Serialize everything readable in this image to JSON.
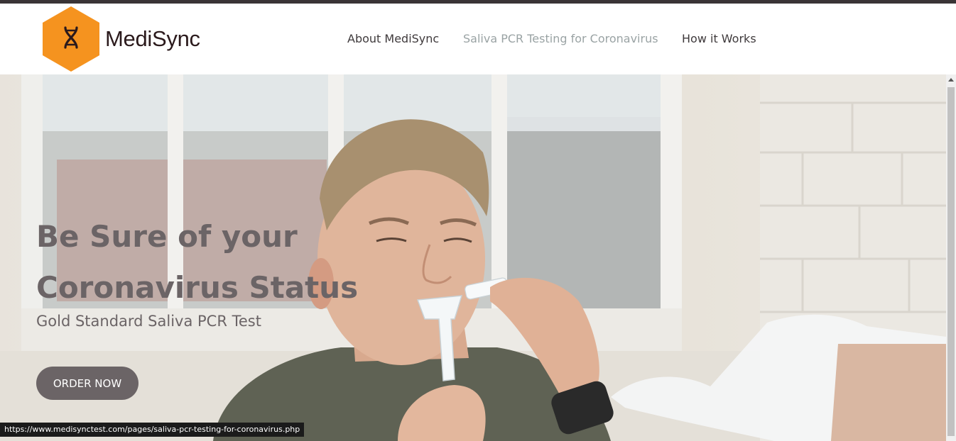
{
  "brand": {
    "name": "MediSync",
    "logo_color": "#f5931f",
    "logo_icon": "dna-icon"
  },
  "nav": {
    "items": [
      {
        "label": "About MediSync",
        "active": false
      },
      {
        "label": "Saliva PCR Testing for Coronavirus",
        "active": true
      },
      {
        "label": "How it Works",
        "active": false
      }
    ]
  },
  "hero": {
    "headline_line1": "Be Sure of your",
    "headline_line2": "Coronavirus Status",
    "subheadline": "Gold Standard Saliva PCR Test",
    "cta_label": "ORDER NOW",
    "text_color": "#6b6466"
  },
  "status_bar": {
    "url": "https://www.medisynctest.com/pages/saliva-pcr-testing-for-coronavirus.php"
  }
}
